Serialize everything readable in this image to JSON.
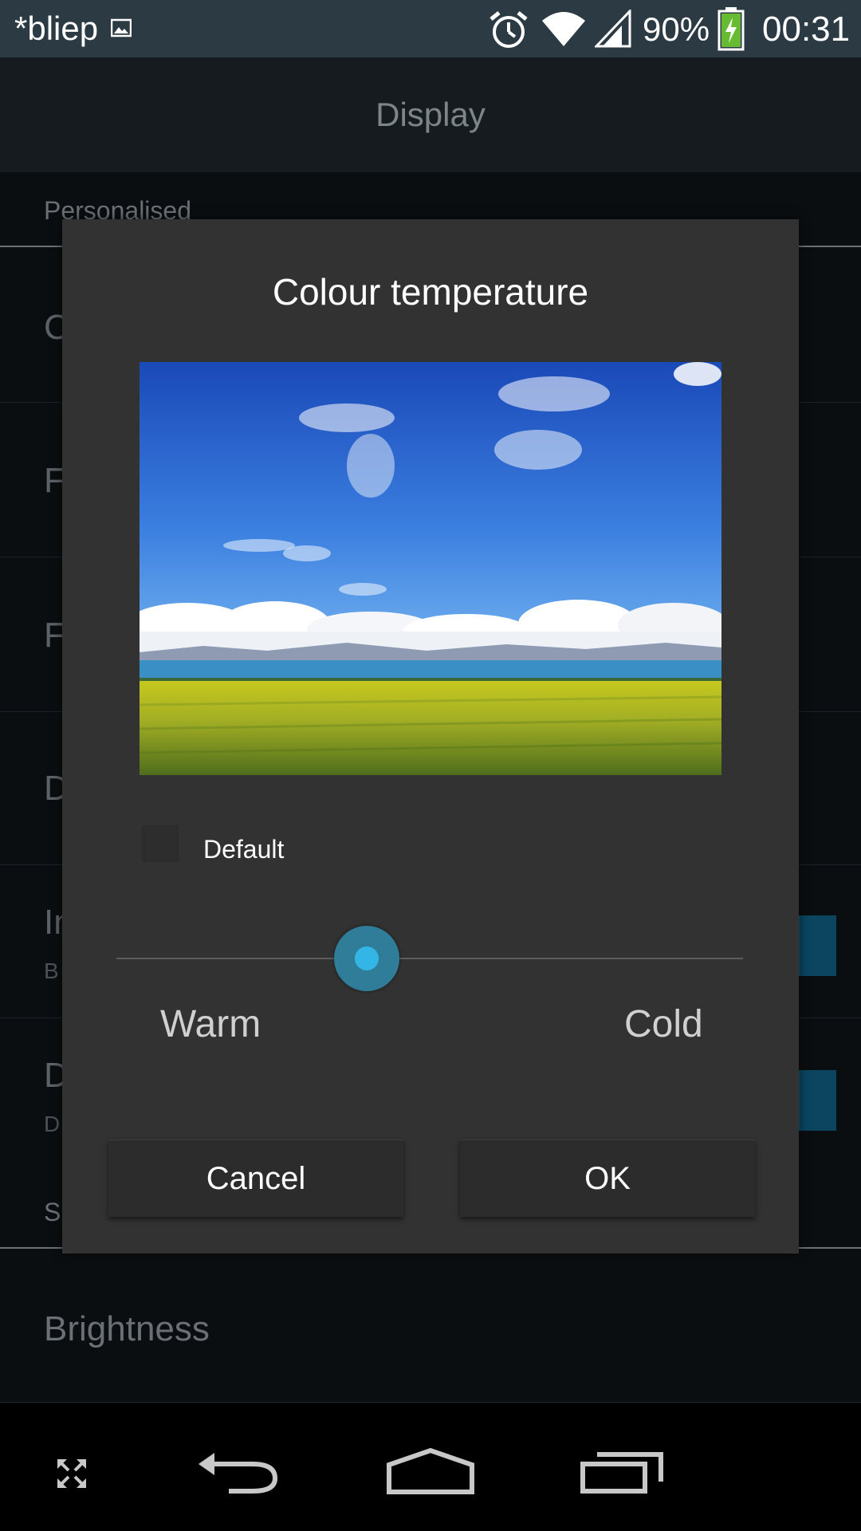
{
  "status_bar": {
    "app_name": "*bliep",
    "battery_percent": "90%",
    "time": "00:31",
    "icons": [
      "image-icon",
      "alarm-icon",
      "wifi-icon",
      "signal-icon",
      "battery-charging-icon"
    ]
  },
  "app_bar": {
    "title": "Display"
  },
  "settings": {
    "section_personalised": "Personalised",
    "row_initials": [
      "C",
      "F",
      "F",
      "D",
      "In",
      "D"
    ],
    "sub_initials": [
      "B",
      "D"
    ],
    "section_cut": "S",
    "brightness_label": "Brightness",
    "toggle_accent": "#0b4560"
  },
  "dialog": {
    "title": "Colour temperature",
    "default_label": "Default",
    "default_checked": false,
    "slider": {
      "warm_label": "Warm",
      "cold_label": "Cold",
      "value_fraction": 0.4
    },
    "cancel_label": "Cancel",
    "ok_label": "OK",
    "accent_color": "#33b5e5"
  },
  "nav_bar": {
    "icons": [
      "expand-icon",
      "back-icon",
      "home-icon",
      "recents-icon"
    ]
  }
}
